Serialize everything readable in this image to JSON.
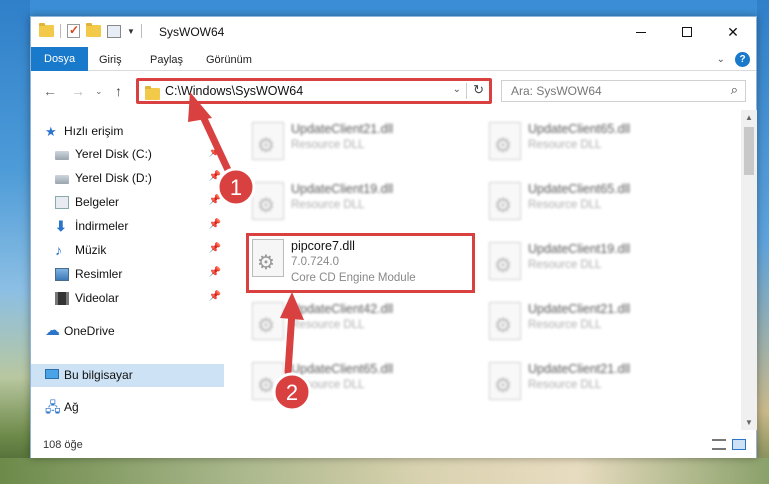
{
  "window": {
    "title": "SysWOW64"
  },
  "ribbon": {
    "tabs": [
      "Dosya",
      "Giriş",
      "Paylaş",
      "Görünüm"
    ]
  },
  "address": {
    "path": "C:\\Windows\\SysWOW64"
  },
  "search": {
    "placeholder": "Ara: SysWOW64"
  },
  "sidebar": {
    "items": [
      {
        "label": "Hızlı erişim",
        "icon": "star-icon"
      },
      {
        "label": "Yerel Disk (C:)",
        "icon": "drive-icon"
      },
      {
        "label": "Yerel Disk (D:)",
        "icon": "drive-icon"
      },
      {
        "label": "Belgeler",
        "icon": "documents-icon"
      },
      {
        "label": "İndirmeler",
        "icon": "download-icon"
      },
      {
        "label": "Müzik",
        "icon": "music-icon"
      },
      {
        "label": "Resimler",
        "icon": "pictures-icon"
      },
      {
        "label": "Videolar",
        "icon": "videos-icon"
      },
      {
        "label": "OneDrive",
        "icon": "cloud-icon"
      },
      {
        "label": "Bu bilgisayar",
        "icon": "computer-icon"
      },
      {
        "label": "Ağ",
        "icon": "network-icon"
      }
    ]
  },
  "files": {
    "left": [
      {
        "name": "UpdateClient21.dll",
        "desc": "Resource DLL"
      },
      {
        "name": "UpdateClient19.dll",
        "desc": "Resource DLL"
      },
      {
        "name": "pipcore7.dll",
        "version": "7.0.724.0",
        "desc": "Core CD Engine Module"
      },
      {
        "name": "UpdateClient42.dll",
        "desc": "Resource DLL"
      },
      {
        "name": "UpdateClient65.dll",
        "desc": "Resource DLL"
      }
    ],
    "right": [
      {
        "name": "UpdateClient65.dll",
        "desc": "Resource DLL"
      },
      {
        "name": "UpdateClient65.dll",
        "desc": "Resource DLL"
      },
      {
        "name": "UpdateClient19.dll",
        "desc": "Resource DLL"
      },
      {
        "name": "UpdateClient21.dll",
        "desc": "Resource DLL"
      },
      {
        "name": "UpdateClient21.dll",
        "desc": "Resource DLL"
      }
    ]
  },
  "status": {
    "count": "108 öğe"
  },
  "annotations": {
    "badge1": "1",
    "badge2": "2",
    "accent": "#d94040"
  }
}
